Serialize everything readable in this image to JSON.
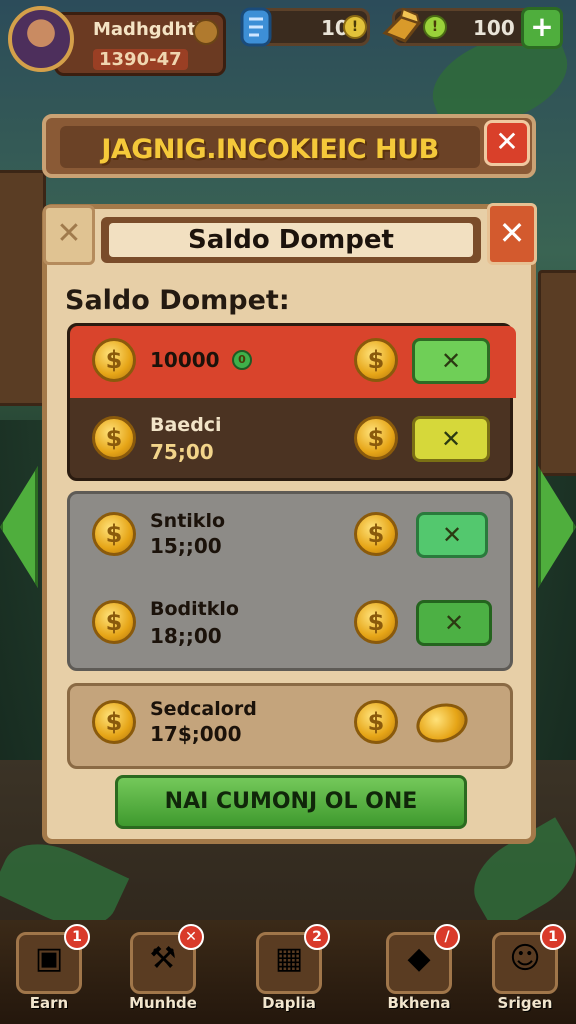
{
  "profile": {
    "name": "Madhgdhtk",
    "level": "1390-47"
  },
  "resources": [
    {
      "icon": "scroll-icon",
      "value": "10"
    },
    {
      "icon": "gold-bar-icon",
      "value": "100"
    }
  ],
  "hub": {
    "title": "JAGNIG.INCOKIEIC HUB",
    "close_symbol": "✕"
  },
  "panel": {
    "header_title": "Saldo Dompet",
    "section_label": "Saldo Dompet:",
    "close_symbol": "✕",
    "coin_symbol": "$",
    "rows": [
      {
        "name": "",
        "amount": "10000",
        "button": "✕"
      },
      {
        "name": "Baedci",
        "amount": "75;00",
        "button": "✕"
      },
      {
        "name": "Sntiklo",
        "amount": "15;;00",
        "button": "✕"
      },
      {
        "name": "Boditklo",
        "amount": "18;;00",
        "button": "✕"
      },
      {
        "name": "Sedcalord",
        "amount": "17$;000",
        "button": ""
      }
    ],
    "primary_button": "NAI CUMONJ OL ONE"
  },
  "nav": [
    {
      "label": "Earn",
      "badge": "1",
      "icon": "chest-icon"
    },
    {
      "label": "Munhde",
      "badge": "✕",
      "icon": "hammer-icon"
    },
    {
      "label": "Daplia",
      "badge": "2",
      "icon": "crate-icon"
    },
    {
      "label": "Bkhena",
      "badge": "/",
      "icon": "gift-icon"
    },
    {
      "label": "Srigen",
      "badge": "1",
      "icon": "character-icon"
    }
  ],
  "colors": {
    "accent_red": "#d9402a",
    "accent_green": "#4fae3d",
    "gold": "#e6a517",
    "panel_bg": "#e7cfa7"
  }
}
